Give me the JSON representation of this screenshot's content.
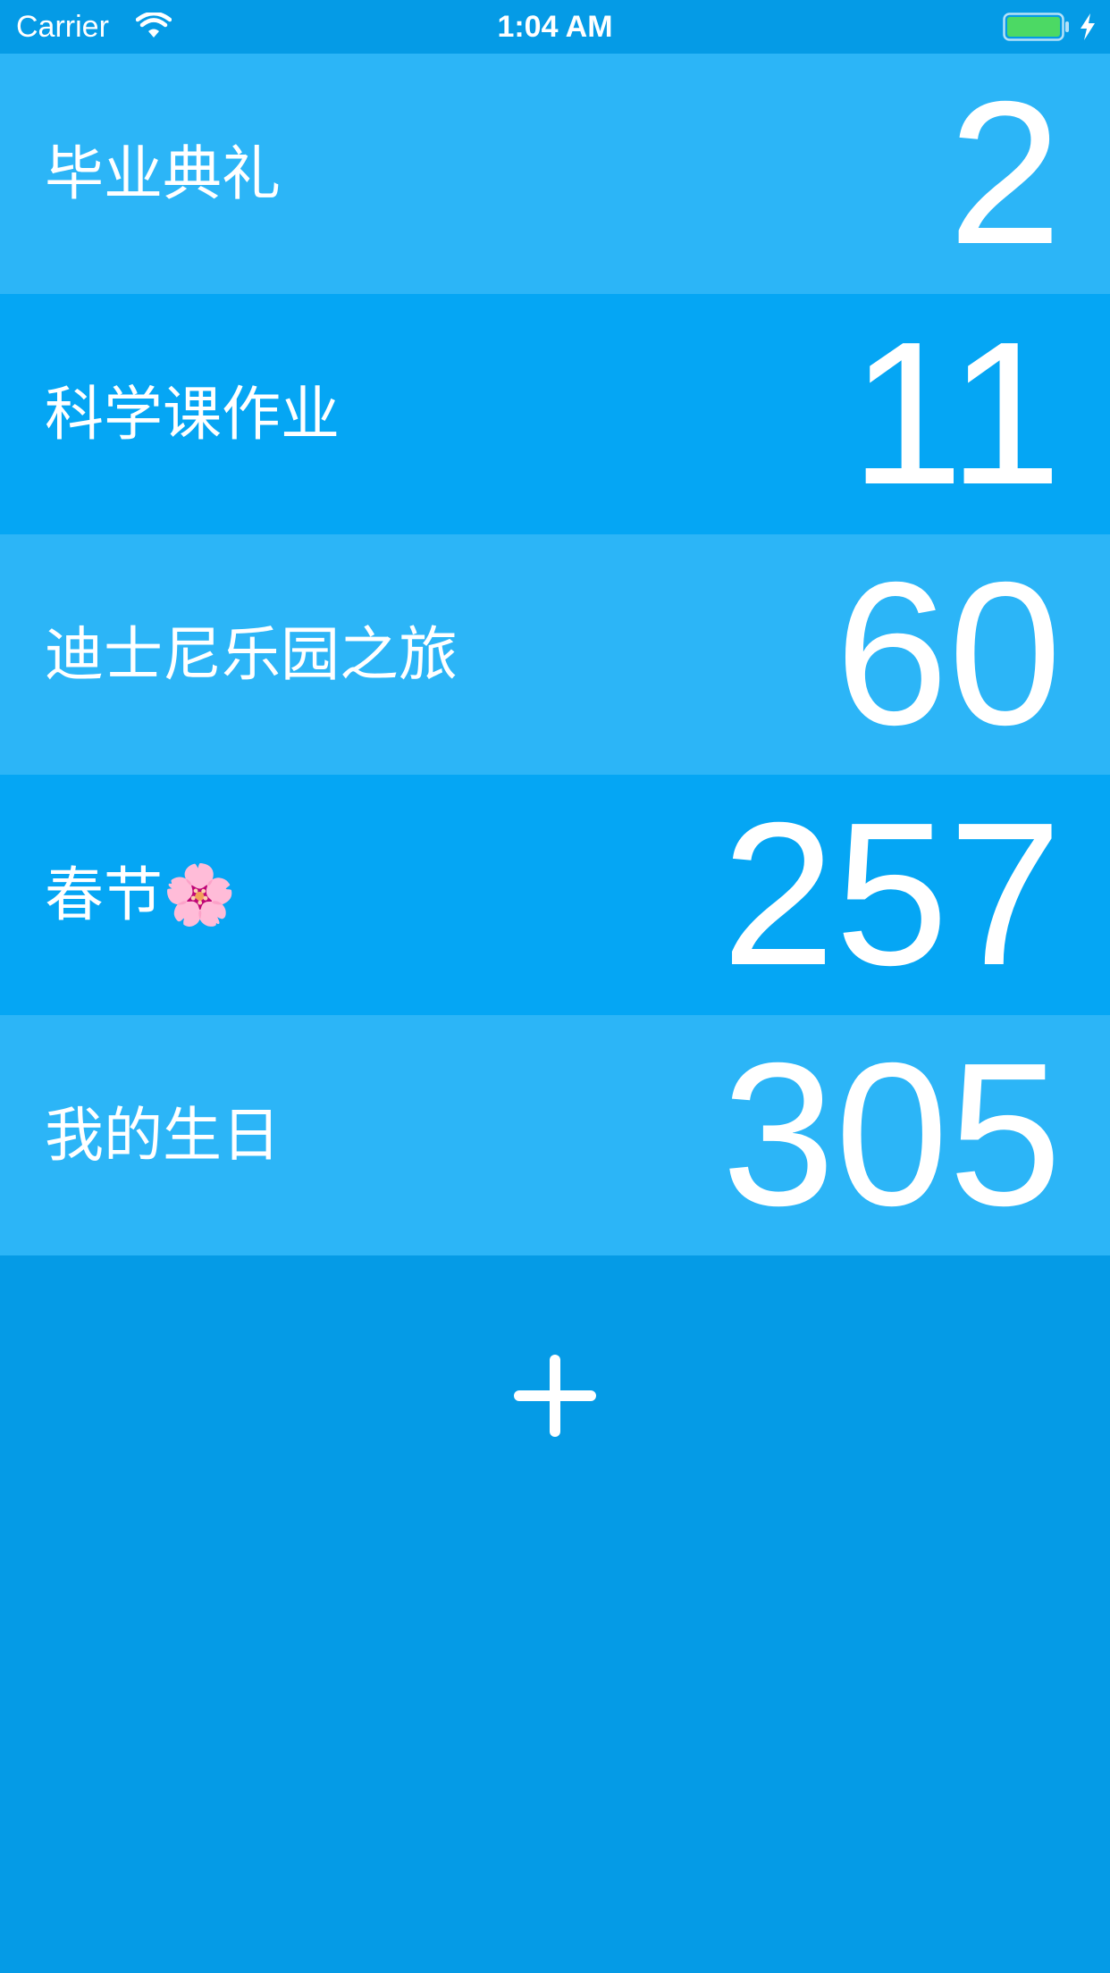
{
  "status_bar": {
    "carrier": "Carrier",
    "time": "1:04 AM",
    "wifi_icon": "wifi-icon",
    "battery_icon": "battery-charging-icon",
    "battery_color": "#4cd964"
  },
  "events": [
    {
      "title": "毕业典礼",
      "days": "2"
    },
    {
      "title": "科学课作业",
      "days": "11"
    },
    {
      "title": "迪士尼乐园之旅",
      "days": "60"
    },
    {
      "title": "春节🌸",
      "days": "257"
    },
    {
      "title": "我的生日",
      "days": "305"
    }
  ],
  "add_button": {
    "icon": "plus-icon"
  },
  "colors": {
    "background": "#059be6",
    "row_light": "#2cb5f7",
    "row_dark": "#05a6f4",
    "text": "#ffffff"
  }
}
